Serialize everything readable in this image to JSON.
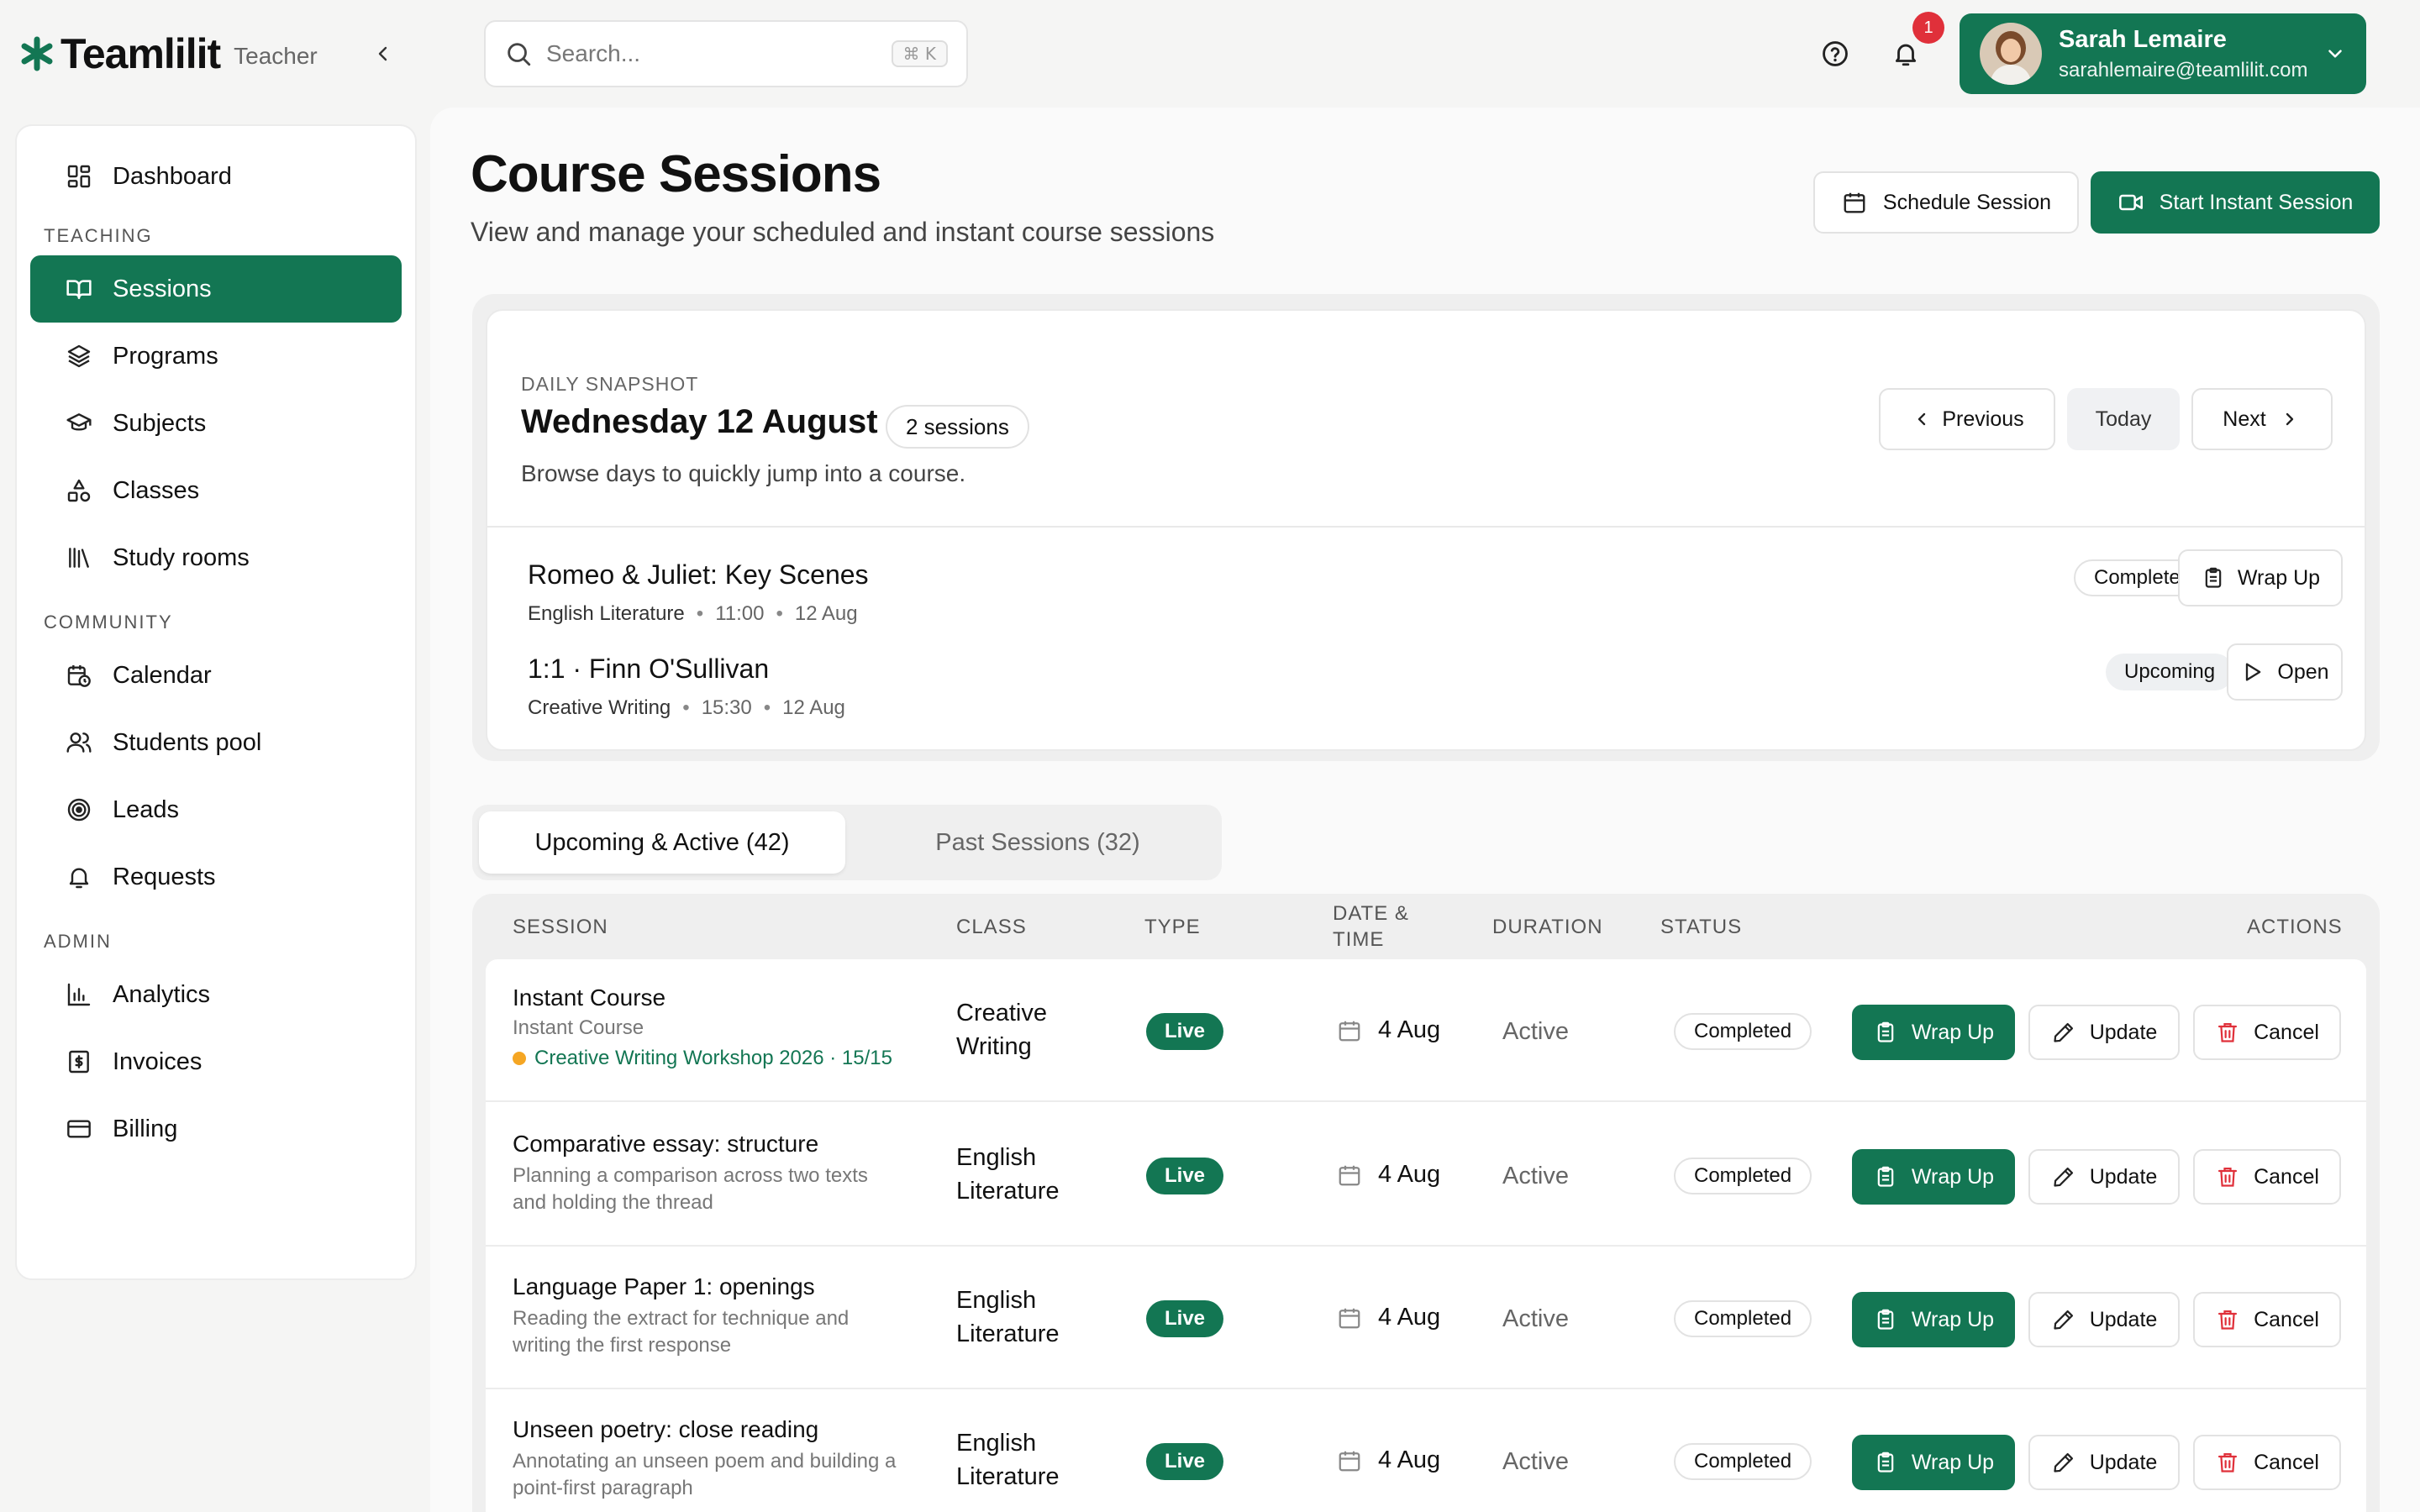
{
  "app": {
    "brand": "Teamlilit",
    "role": "Teacher",
    "brand_color": "#137653"
  },
  "search": {
    "placeholder": "Search...",
    "shortcut": "⌘ K"
  },
  "notifications": {
    "count": "1"
  },
  "user": {
    "name": "Sarah Lemaire",
    "email": "sarahlemaire@teamlilit.com"
  },
  "sidebar": {
    "dashboard": "Dashboard",
    "sections": {
      "teaching": "TEACHING",
      "community": "COMMUNITY",
      "admin": "ADMIN"
    },
    "teaching_items": [
      {
        "label": "Sessions",
        "icon": "book-open-icon",
        "active": true
      },
      {
        "label": "Programs",
        "icon": "layers-icon"
      },
      {
        "label": "Subjects",
        "icon": "graduation-cap-icon"
      },
      {
        "label": "Classes",
        "icon": "shapes-icon"
      },
      {
        "label": "Study rooms",
        "icon": "library-icon"
      }
    ],
    "community_items": [
      {
        "label": "Calendar",
        "icon": "calendar-clock-icon"
      },
      {
        "label": "Students pool",
        "icon": "users-icon"
      },
      {
        "label": "Leads",
        "icon": "target-icon"
      },
      {
        "label": "Requests",
        "icon": "bell-icon"
      }
    ],
    "admin_items": [
      {
        "label": "Analytics",
        "icon": "bar-chart-icon"
      },
      {
        "label": "Invoices",
        "icon": "receipt-icon"
      },
      {
        "label": "Billing",
        "icon": "credit-card-icon"
      }
    ]
  },
  "page": {
    "title": "Course Sessions",
    "subtitle": "View and manage your scheduled and instant course sessions",
    "schedule_button": "Schedule Session",
    "instant_button": "Start Instant Session"
  },
  "snapshot": {
    "kicker": "DAILY SNAPSHOT",
    "date": "Wednesday 12 August",
    "count": "2 sessions",
    "description": "Browse days to quickly jump into a course.",
    "prev": "Previous",
    "today": "Today",
    "next": "Next",
    "items": [
      {
        "title": "Romeo & Juliet: Key Scenes",
        "subject": "English Literature",
        "time": "11:00",
        "date": "12 Aug",
        "status": "Completed",
        "action": "Wrap Up"
      },
      {
        "title": "1:1 · Finn O'Sullivan",
        "subject": "Creative Writing",
        "time": "15:30",
        "date": "12 Aug",
        "status": "Upcoming",
        "action": "Open"
      }
    ]
  },
  "tabs": {
    "upcoming": "Upcoming & Active (42)",
    "past": "Past Sessions (32)"
  },
  "table": {
    "headers": {
      "session": "SESSION",
      "class": "CLASS",
      "type": "TYPE",
      "date_line1": "DATE &",
      "date_line2": "TIME",
      "duration": "DURATION",
      "status": "STATUS",
      "actions": "ACTIONS"
    },
    "actions": {
      "wrap": "Wrap Up",
      "update": "Update",
      "cancel": "Cancel"
    },
    "rows": [
      {
        "title": "Instant Course",
        "sub": "Instant Course",
        "program": "Creative Writing Workshop 2026 · 15/15",
        "class_line1": "Creative",
        "class_line2": "Writing",
        "type": "Live",
        "date": "4 Aug",
        "duration": "Active",
        "status": "Completed"
      },
      {
        "title": "Comparative essay: structure",
        "sub_line1": "Planning a comparison across two texts",
        "sub_line2": "and holding the thread",
        "class_line1": "English",
        "class_line2": "Literature",
        "type": "Live",
        "date": "4 Aug",
        "duration": "Active",
        "status": "Completed"
      },
      {
        "title": "Language Paper 1: openings",
        "sub_line1": "Reading the extract for technique and",
        "sub_line2": "writing the first response",
        "class_line1": "English",
        "class_line2": "Literature",
        "type": "Live",
        "date": "4 Aug",
        "duration": "Active",
        "status": "Completed"
      },
      {
        "title": "Unseen poetry: close reading",
        "sub_line1": "Annotating an unseen poem and building a",
        "sub_line2": "point-first paragraph",
        "class_line1": "English",
        "class_line2": "Literature",
        "type": "Live",
        "date": "4 Aug",
        "duration": "Active",
        "status": "Completed"
      }
    ]
  }
}
